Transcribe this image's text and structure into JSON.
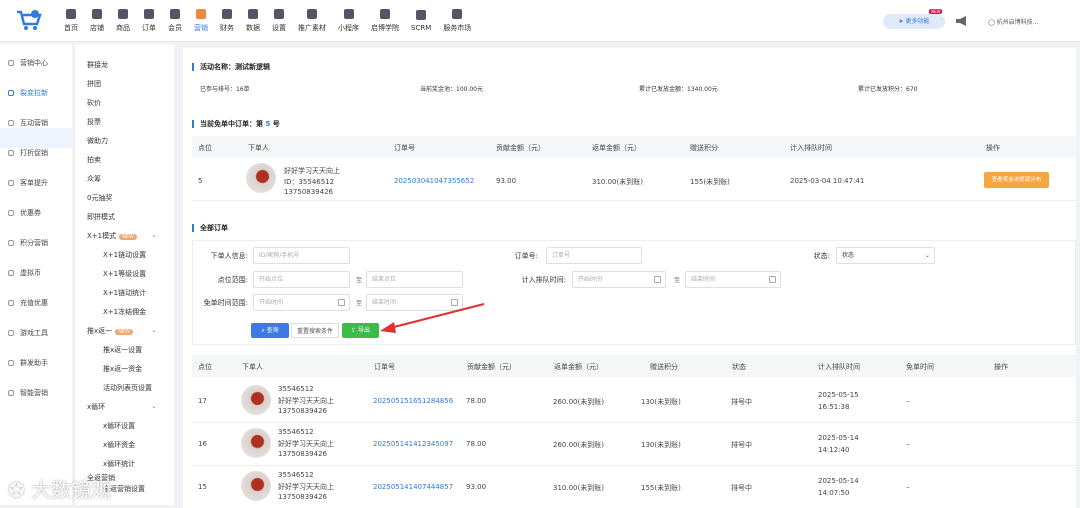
{
  "nav": [
    "首页",
    "店铺",
    "商品",
    "订单",
    "会员",
    "营销",
    "财务",
    "数据",
    "设置",
    "推广素材",
    "小程序",
    "启博学院",
    "SCRM",
    "服务市场"
  ],
  "nav_active": "营销",
  "header": {
    "more": "更多功能",
    "new_tag": "NEW",
    "shop": "杭州启博科技..."
  },
  "sidebar": [
    "营销中心",
    "裂变拉新",
    "互动营销",
    "打折促销",
    "客单提升",
    "优惠券",
    "积分营销",
    "虚拟币",
    "充值优惠",
    "游戏工具",
    "群发助手",
    "智能营销"
  ],
  "sidebar_active": "裂变拉新",
  "submenu": {
    "items": [
      "群接龙",
      "拼团",
      "砍价",
      "投票",
      "微助力",
      "拍卖",
      "众筹",
      "0元抽奖",
      "即拼模式"
    ],
    "group1": {
      "label": "X+1模式",
      "badge": "NEW",
      "children": [
        "X+1链动设置",
        "X+1等级设置",
        "X+1链动统计",
        "X+1冻结佣金"
      ]
    },
    "group2": {
      "label": "推x返一",
      "badge": "NEW",
      "children": [
        "推x返一设置",
        "推x返一资金",
        "活动列表页设置"
      ]
    },
    "group3": {
      "label": "x循环",
      "children": [
        "x循环设置",
        "x循环资金",
        "x循环统计"
      ]
    },
    "group4_partial": "全返营销",
    "group4_child": "全返营销设置"
  },
  "activity": {
    "title": "活动名称：测试新逻辑",
    "joined": "已参与排号：16单",
    "pool": "当前奖金池：100.00元",
    "paid": "累计已发放金额：1340.00元",
    "points": "累计已发放积分：670"
  },
  "current": {
    "title_prefix": "当前免单中订单：第",
    "num": "5",
    "title_suffix": "号",
    "headers": [
      "点位",
      "下单人",
      "订单号",
      "贡献金额（元）",
      "返单金额（元）",
      "赠送积分",
      "计入排队时间",
      "操作"
    ],
    "row": {
      "pos": "5",
      "name": "好好学习天天向上",
      "id": "ID：35546512",
      "phone": "13750839426",
      "order": "202503041047355652",
      "contrib": "93.00",
      "refund": "310.00(未到账)",
      "points": "155(未到账)",
      "time": "2025-03-04 10:47:41",
      "action": "查看奖金池提现分布"
    }
  },
  "all": {
    "title": "全部订单",
    "filter": {
      "buyer_label": "下单人信息:",
      "buyer_ph": "ID/昵称/手机号",
      "order_label": "订单号:",
      "order_ph": "订单号",
      "status_label": "状态:",
      "status_val": "状态",
      "pos_label": "点位范围:",
      "pos_start": "开始点位",
      "pos_end": "结束点位",
      "queue_label": "计入排队时间:",
      "q_start": "开始时间",
      "q_end": "结束时间",
      "free_label": "免单时间范围:",
      "f_start": "开始时间",
      "f_end": "结束时间",
      "to": "至",
      "search": "查询",
      "reset": "重置搜索条件",
      "export": "导出"
    },
    "headers": [
      "点位",
      "下单人",
      "订单号",
      "贡献金额（元）",
      "返单金额（元）",
      "赠送积分",
      "状态",
      "计入排队时间",
      "免单时间",
      "操作"
    ],
    "rows": [
      {
        "pos": "17",
        "uid": "35546512",
        "name": "好好学习天天向上",
        "phone": "13750839426",
        "order": "202505151651284856",
        "contrib": "78.00",
        "refund": "260.00(未到账)",
        "points": "130(未到账)",
        "status": "排号中",
        "date": "2025-05-15",
        "time": "16:51:38",
        "free": "–"
      },
      {
        "pos": "16",
        "uid": "35546512",
        "name": "好好学习天天向上",
        "phone": "13750839426",
        "order": "202505141412345097",
        "contrib": "78.00",
        "refund": "260.00(未到账)",
        "points": "130(未到账)",
        "status": "排号中",
        "date": "2025-05-14",
        "time": "14:12:40",
        "free": "–"
      },
      {
        "pos": "15",
        "uid": "35546512",
        "name": "好好学习天天向上",
        "phone": "13750839426",
        "order": "202505141407444857",
        "contrib": "93.00",
        "refund": "310.00(未到账)",
        "points": "155(未到账)",
        "status": "排号中",
        "date": "2025-05-14",
        "time": "14:07:50",
        "free": "–"
      }
    ]
  },
  "watermark": "大数镜观",
  "colors": {
    "accent": "#2f7bd8",
    "export": "#3cba4a",
    "orange": "#f5a640"
  }
}
